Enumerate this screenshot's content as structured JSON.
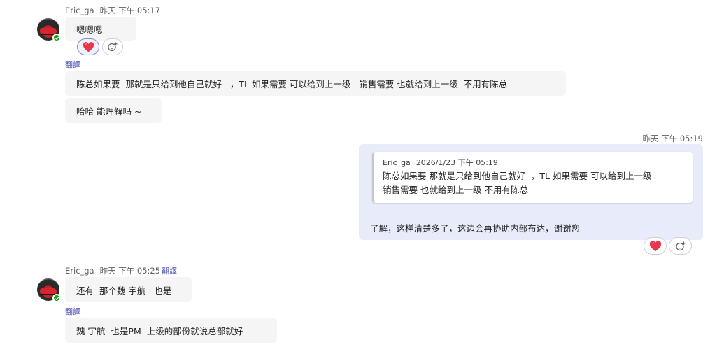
{
  "messages": [
    {
      "sender": "Eric_ga",
      "time": "昨天 下午 05:17",
      "bubbles": [
        "嗯嗯嗯"
      ],
      "reactions": {
        "heart": "heart-emoji",
        "add": "add-reaction-icon"
      }
    },
    {
      "translate_label": "翻譯",
      "bubbles": [
        "陈总如果要  那就是只给到他自己就好   ，TL 如果需要 可以给到上一级   销售需要 也就给到上一级  不用有陈总",
        "哈哈 能理解吗 ~"
      ]
    },
    {
      "mine": true,
      "time": "昨天 下午 05:19",
      "quote": {
        "sender": "Eric_ga",
        "time": "2026/1/23 下午 05:19",
        "line1": "陈总如果要 那就是只给到他自己就好  ，TL 如果需要 可以给到上一级",
        "line2": "销售需要 也就给到上一级 不用有陈总"
      },
      "text": "了解，这样清楚多了，这边会再协助内部布达，谢谢您"
    },
    {
      "sender": "Eric_ga",
      "time": "昨天 下午 05:25",
      "translate_label": "翻譯",
      "bubbles": [
        "还有  那个魏 宇航   也是"
      ]
    },
    {
      "translate_label": "翻譯",
      "bubbles": [
        "魏 宇航  也是PM  上级的部份就说总部就好"
      ]
    }
  ],
  "colors": {
    "presence": "#13a10e",
    "heart": "#e8364b",
    "translate": "#4f52b2",
    "my_bubble": "#e8ebfa",
    "other_bubble": "#f5f5f5"
  }
}
